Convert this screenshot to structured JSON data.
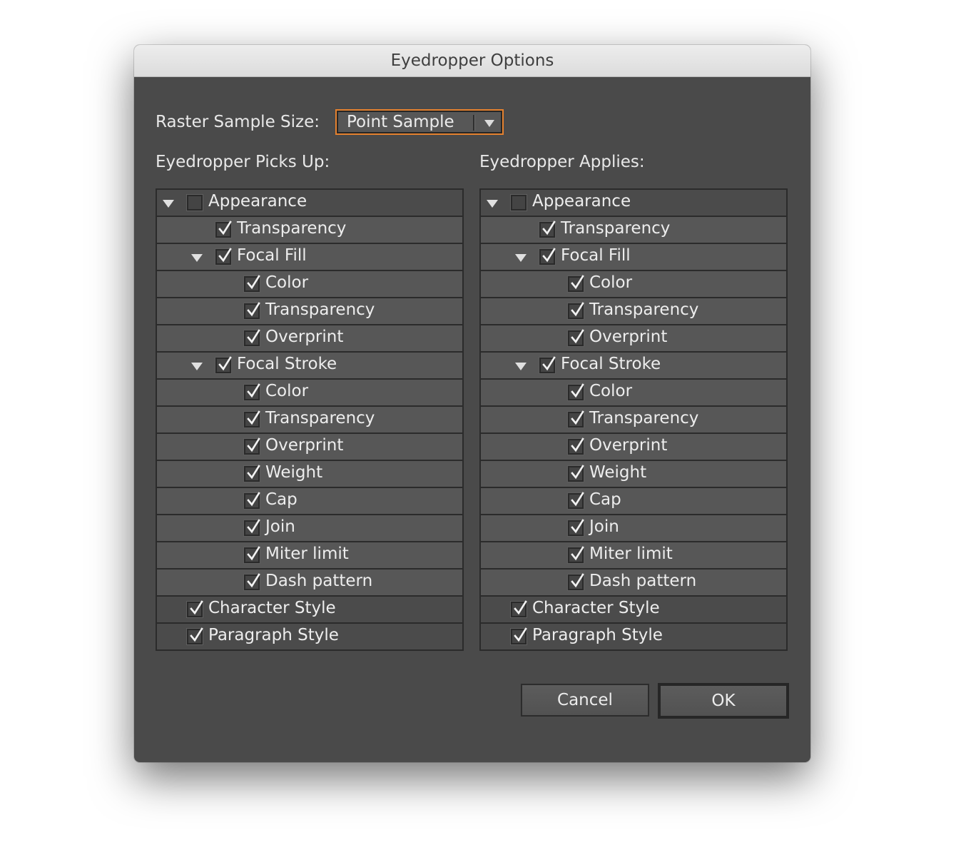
{
  "dialog": {
    "title": "Eyedropper Options",
    "raster_label": "Raster Sample Size:",
    "raster_value": "Point Sample",
    "picks_up_label": "Eyedropper Picks Up:",
    "applies_label": "Eyedropper Applies:",
    "cancel_label": "Cancel",
    "ok_label": "OK"
  },
  "picks_up": [
    {
      "label": "Appearance",
      "checked": false,
      "level": 0,
      "expander": true
    },
    {
      "label": "Transparency",
      "checked": true,
      "level": 1,
      "expander": false
    },
    {
      "label": "Focal Fill",
      "checked": true,
      "level": 1,
      "expander": true
    },
    {
      "label": "Color",
      "checked": true,
      "level": 2,
      "expander": false
    },
    {
      "label": "Transparency",
      "checked": true,
      "level": 2,
      "expander": false
    },
    {
      "label": "Overprint",
      "checked": true,
      "level": 2,
      "expander": false
    },
    {
      "label": "Focal Stroke",
      "checked": true,
      "level": 1,
      "expander": true
    },
    {
      "label": "Color",
      "checked": true,
      "level": 2,
      "expander": false
    },
    {
      "label": "Transparency",
      "checked": true,
      "level": 2,
      "expander": false
    },
    {
      "label": "Overprint",
      "checked": true,
      "level": 2,
      "expander": false
    },
    {
      "label": "Weight",
      "checked": true,
      "level": 2,
      "expander": false
    },
    {
      "label": "Cap",
      "checked": true,
      "level": 2,
      "expander": false
    },
    {
      "label": "Join",
      "checked": true,
      "level": 2,
      "expander": false
    },
    {
      "label": "Miter limit",
      "checked": true,
      "level": 2,
      "expander": false
    },
    {
      "label": "Dash pattern",
      "checked": true,
      "level": 2,
      "expander": false
    },
    {
      "label": "Character Style",
      "checked": true,
      "level": 0,
      "expander": false
    },
    {
      "label": "Paragraph Style",
      "checked": true,
      "level": 0,
      "expander": false
    }
  ],
  "applies": [
    {
      "label": "Appearance",
      "checked": false,
      "level": 0,
      "expander": true
    },
    {
      "label": "Transparency",
      "checked": true,
      "level": 1,
      "expander": false
    },
    {
      "label": "Focal Fill",
      "checked": true,
      "level": 1,
      "expander": true
    },
    {
      "label": "Color",
      "checked": true,
      "level": 2,
      "expander": false
    },
    {
      "label": "Transparency",
      "checked": true,
      "level": 2,
      "expander": false
    },
    {
      "label": "Overprint",
      "checked": true,
      "level": 2,
      "expander": false
    },
    {
      "label": "Focal Stroke",
      "checked": true,
      "level": 1,
      "expander": true
    },
    {
      "label": "Color",
      "checked": true,
      "level": 2,
      "expander": false
    },
    {
      "label": "Transparency",
      "checked": true,
      "level": 2,
      "expander": false
    },
    {
      "label": "Overprint",
      "checked": true,
      "level": 2,
      "expander": false
    },
    {
      "label": "Weight",
      "checked": true,
      "level": 2,
      "expander": false
    },
    {
      "label": "Cap",
      "checked": true,
      "level": 2,
      "expander": false
    },
    {
      "label": "Join",
      "checked": true,
      "level": 2,
      "expander": false
    },
    {
      "label": "Miter limit",
      "checked": true,
      "level": 2,
      "expander": false
    },
    {
      "label": "Dash pattern",
      "checked": true,
      "level": 2,
      "expander": false
    },
    {
      "label": "Character Style",
      "checked": true,
      "level": 0,
      "expander": false
    },
    {
      "label": "Paragraph Style",
      "checked": true,
      "level": 0,
      "expander": false
    }
  ],
  "colors": {
    "focus_ring": "#e5812e",
    "dialog_bg": "#4a4a4a"
  }
}
